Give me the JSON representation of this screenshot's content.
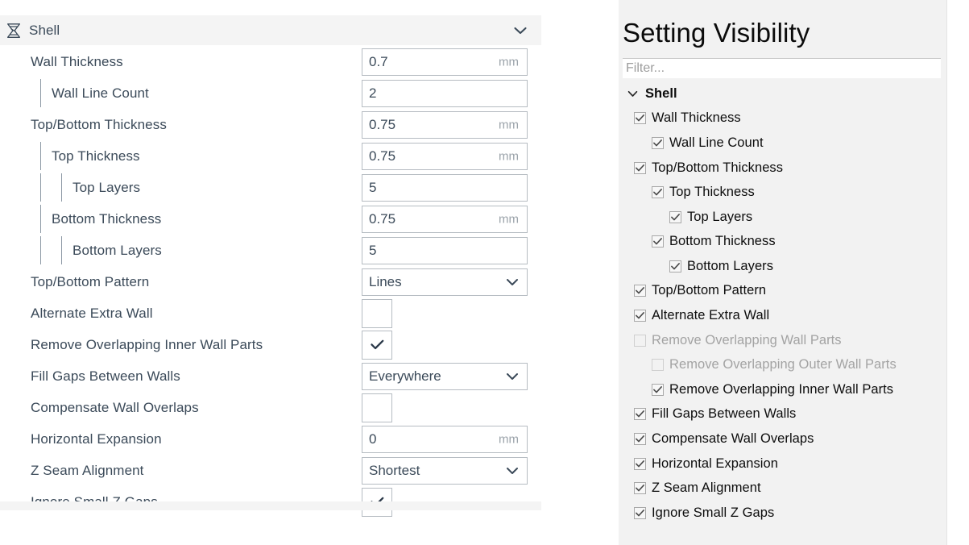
{
  "settings_panel": {
    "category": {
      "title": "Shell",
      "icon": "shell-category-icon",
      "collapse_icon": "chevron-down-icon",
      "expanded": true
    },
    "rows": [
      {
        "label": "Wall Thickness",
        "indent": 0,
        "control": "text",
        "value": "0.7",
        "unit": "mm"
      },
      {
        "label": "Wall Line Count",
        "indent": 1,
        "control": "text",
        "value": "2",
        "unit": ""
      },
      {
        "label": "Top/Bottom Thickness",
        "indent": 0,
        "control": "text",
        "value": "0.75",
        "unit": "mm"
      },
      {
        "label": "Top Thickness",
        "indent": 1,
        "control": "text",
        "value": "0.75",
        "unit": "mm"
      },
      {
        "label": "Top Layers",
        "indent": 2,
        "control": "text",
        "value": "5",
        "unit": ""
      },
      {
        "label": "Bottom Thickness",
        "indent": 1,
        "control": "text",
        "value": "0.75",
        "unit": "mm"
      },
      {
        "label": "Bottom Layers",
        "indent": 2,
        "control": "text",
        "value": "5",
        "unit": ""
      },
      {
        "label": "Top/Bottom Pattern",
        "indent": 0,
        "control": "dropdown",
        "value": "Lines",
        "unit": ""
      },
      {
        "label": "Alternate Extra Wall",
        "indent": 0,
        "control": "checkbox",
        "checked": false
      },
      {
        "label": "Remove Overlapping Inner Wall Parts",
        "indent": 0,
        "control": "checkbox",
        "checked": true
      },
      {
        "label": "Fill Gaps Between Walls",
        "indent": 0,
        "control": "dropdown",
        "value": "Everywhere",
        "unit": ""
      },
      {
        "label": "Compensate Wall Overlaps",
        "indent": 0,
        "control": "checkbox",
        "checked": false
      },
      {
        "label": "Horizontal Expansion",
        "indent": 0,
        "control": "text",
        "value": "0",
        "unit": "mm"
      },
      {
        "label": "Z Seam Alignment",
        "indent": 0,
        "control": "dropdown",
        "value": "Shortest",
        "unit": ""
      },
      {
        "label": "Ignore Small Z Gaps",
        "indent": 0,
        "control": "checkbox",
        "checked": true
      }
    ]
  },
  "visibility_panel": {
    "title": "Setting Visibility",
    "filter": {
      "value": "",
      "placeholder": "Filter..."
    },
    "tree": [
      {
        "label": "Shell",
        "indent": 0,
        "type": "group",
        "expand_icon": "chevron-down-icon"
      },
      {
        "label": "Wall Thickness",
        "indent": 1,
        "type": "item",
        "checked": true,
        "enabled": true
      },
      {
        "label": "Wall Line Count",
        "indent": 2,
        "type": "item",
        "checked": true,
        "enabled": true
      },
      {
        "label": "Top/Bottom Thickness",
        "indent": 1,
        "type": "item",
        "checked": true,
        "enabled": true
      },
      {
        "label": "Top Thickness",
        "indent": 2,
        "type": "item",
        "checked": true,
        "enabled": true
      },
      {
        "label": "Top Layers",
        "indent": 3,
        "type": "item",
        "checked": true,
        "enabled": true
      },
      {
        "label": "Bottom Thickness",
        "indent": 2,
        "type": "item",
        "checked": true,
        "enabled": true
      },
      {
        "label": "Bottom Layers",
        "indent": 3,
        "type": "item",
        "checked": true,
        "enabled": true
      },
      {
        "label": "Top/Bottom Pattern",
        "indent": 1,
        "type": "item",
        "checked": true,
        "enabled": true
      },
      {
        "label": "Alternate Extra Wall",
        "indent": 1,
        "type": "item",
        "checked": true,
        "enabled": true
      },
      {
        "label": "Remove Overlapping Wall Parts",
        "indent": 1,
        "type": "item",
        "checked": false,
        "enabled": false
      },
      {
        "label": "Remove Overlapping Outer Wall Parts",
        "indent": 2,
        "type": "item",
        "checked": false,
        "enabled": false
      },
      {
        "label": "Remove Overlapping Inner Wall Parts",
        "indent": 2,
        "type": "item",
        "checked": true,
        "enabled": true
      },
      {
        "label": "Fill Gaps Between Walls",
        "indent": 1,
        "type": "item",
        "checked": true,
        "enabled": true
      },
      {
        "label": "Compensate Wall Overlaps",
        "indent": 1,
        "type": "item",
        "checked": true,
        "enabled": true
      },
      {
        "label": "Horizontal Expansion",
        "indent": 1,
        "type": "item",
        "checked": true,
        "enabled": true
      },
      {
        "label": "Z Seam Alignment",
        "indent": 1,
        "type": "item",
        "checked": true,
        "enabled": true
      },
      {
        "label": "Ignore Small Z Gaps",
        "indent": 1,
        "type": "item",
        "checked": true,
        "enabled": true
      }
    ]
  },
  "colors": {
    "label_text": "#3b4a59",
    "field_border": "#b6bcc2",
    "header_background": "#f4f4f4",
    "visibility_background": "#f2f2f2",
    "disabled_text": "#a3a3a3",
    "placeholder_text": "#9d9d9d"
  }
}
